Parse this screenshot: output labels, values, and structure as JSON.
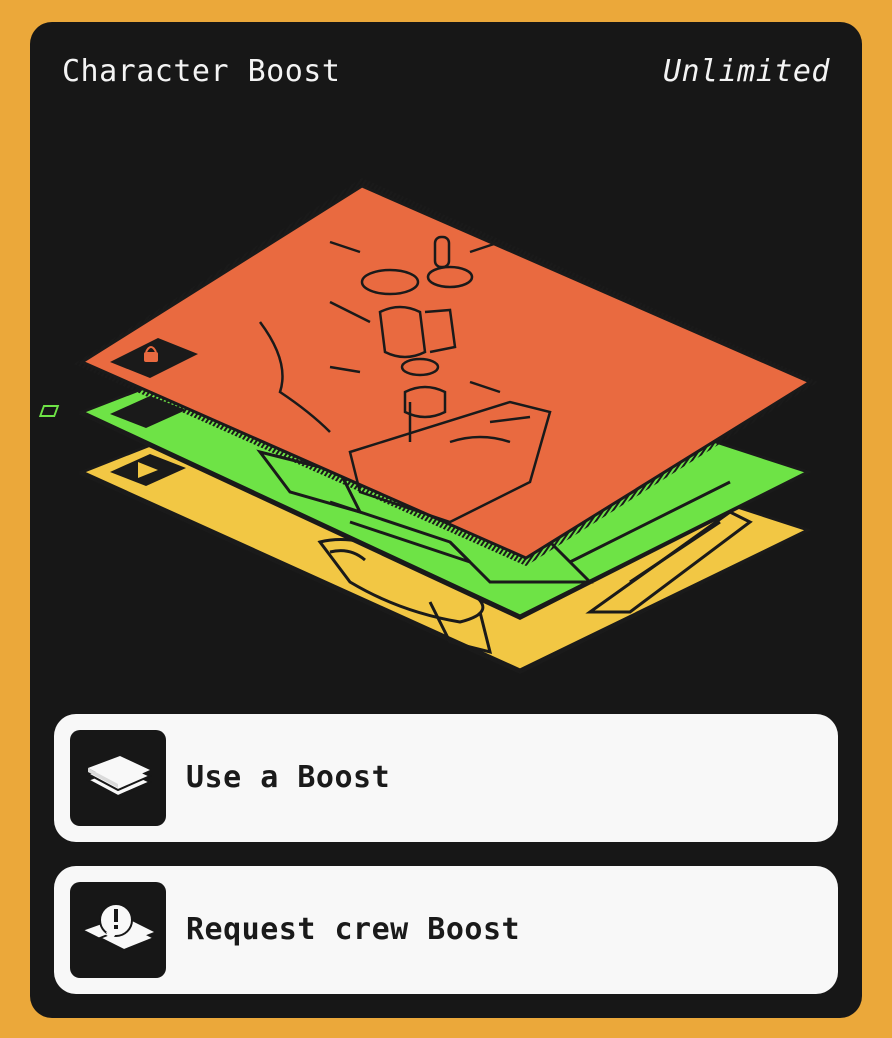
{
  "header": {
    "title": "Character Boost",
    "limit": "Unlimited"
  },
  "layers": [
    {
      "name": "yellow-layer",
      "color": "#F2C744",
      "badge_icon": "play-icon"
    },
    {
      "name": "green-layer",
      "color": "#6EE346",
      "badge_icon": "chip-icon"
    },
    {
      "name": "orange-layer",
      "color": "#E96A40",
      "badge_icon": "lock-icon"
    }
  ],
  "actions": [
    {
      "label": "Use a Boost",
      "icon": "card-stack-icon"
    },
    {
      "label": "Request crew Boost",
      "icon": "card-request-icon"
    }
  ],
  "colors": {
    "background": "#EBA83A",
    "panel": "#171717",
    "button_bg": "#F8F8F8",
    "text_light": "#F4F4F4",
    "text_dark": "#1A1A1A"
  }
}
